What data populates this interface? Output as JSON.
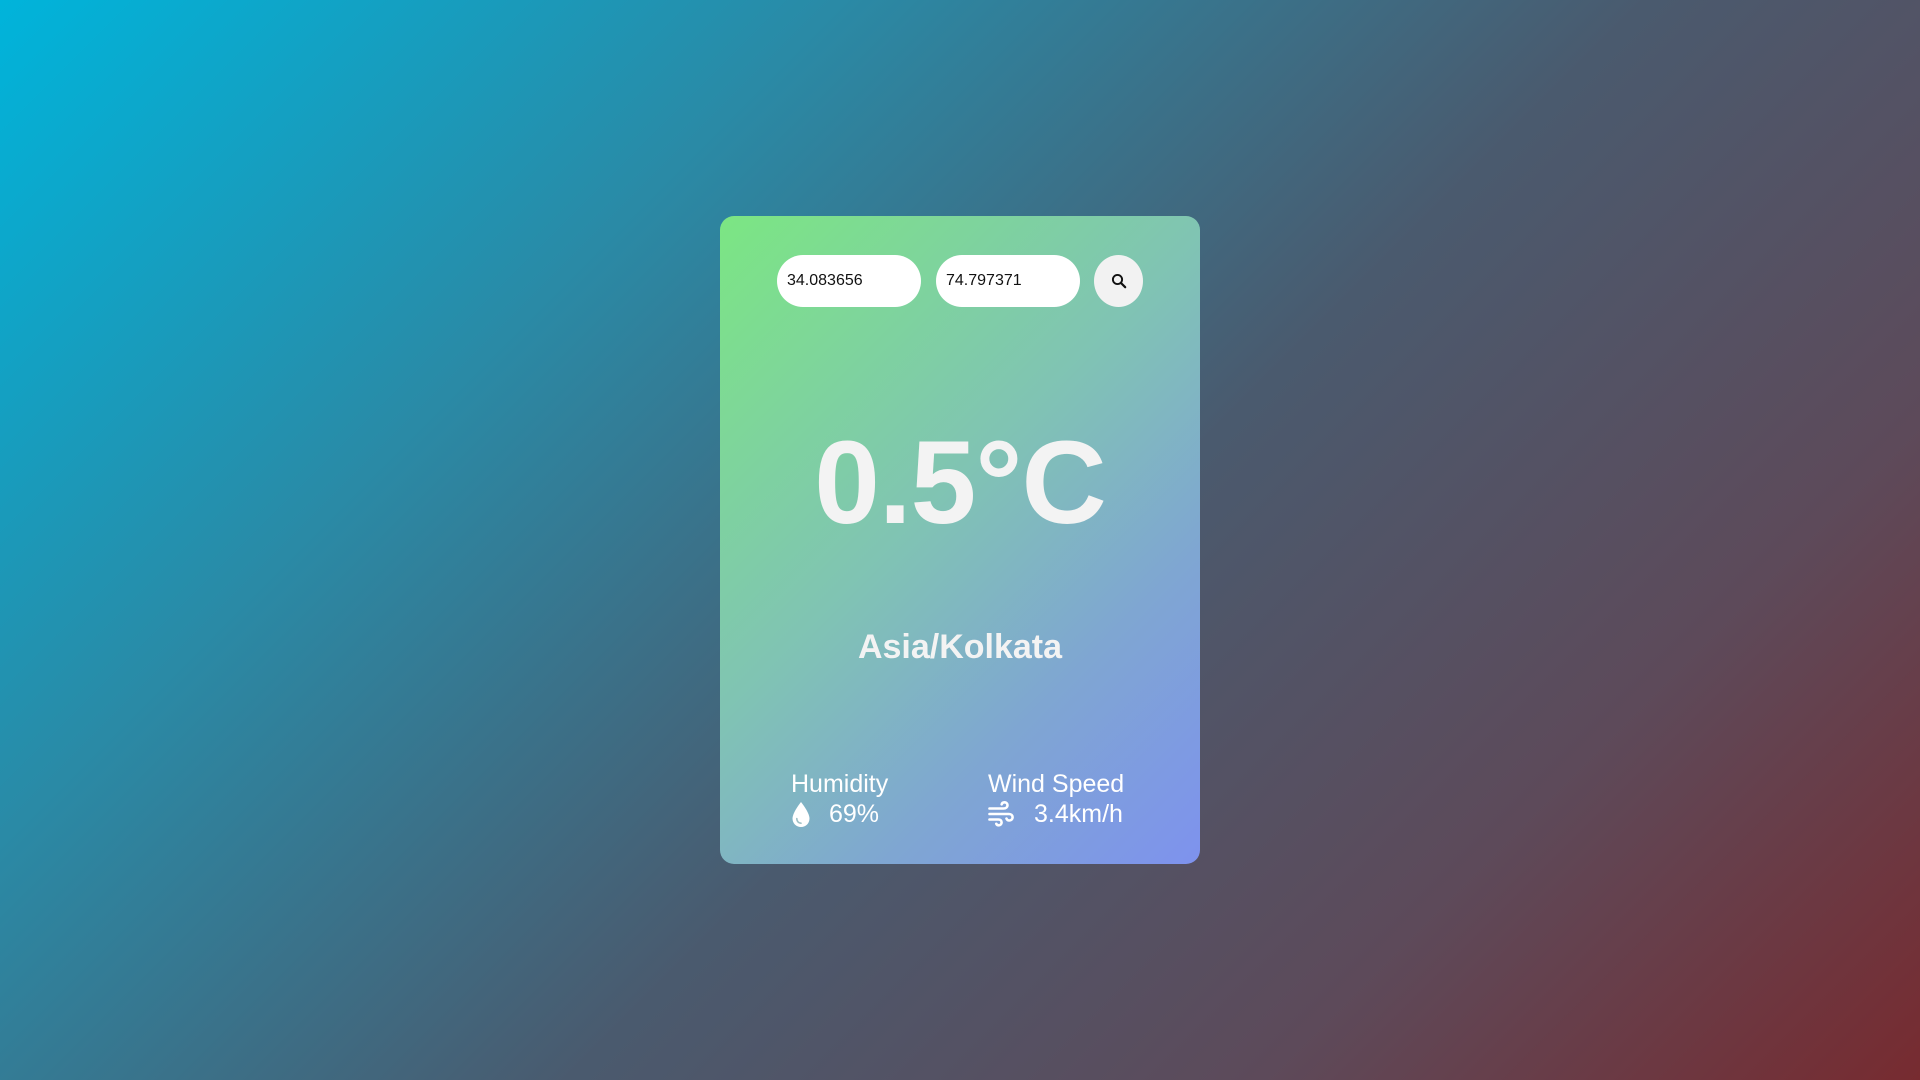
{
  "search": {
    "latitude_value": "34.083656",
    "longitude_value": "74.797371"
  },
  "weather": {
    "temperature": "0.5°C",
    "timezone": "Asia/Kolkata"
  },
  "stats": {
    "humidity_label": "Humidity",
    "humidity_value": "69%",
    "wind_label": "Wind Speed",
    "wind_value": "3.4km/h"
  },
  "icons": {
    "search": "search-icon",
    "humidity": "water-drop-icon",
    "wind": "wind-icon"
  },
  "colors": {
    "page_gradient_start": "#00b4db",
    "page_gradient_end": "#772b30",
    "card_gradient_start": "#7ce683",
    "card_gradient_end": "#7e92ee",
    "text": "#f3f3f3"
  }
}
